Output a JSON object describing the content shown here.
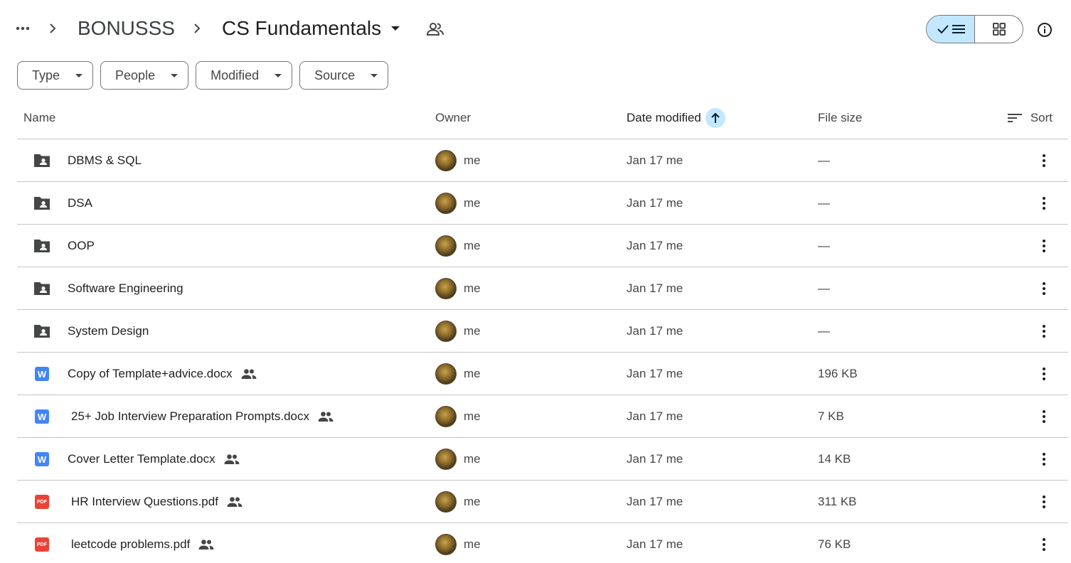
{
  "breadcrumb": {
    "more_label": "More",
    "parent": "BONUSSS",
    "current": "CS Fundamentals"
  },
  "view_toggle": {
    "list_active": true
  },
  "filters": [
    {
      "label": "Type"
    },
    {
      "label": "People"
    },
    {
      "label": "Modified"
    },
    {
      "label": "Source"
    }
  ],
  "table": {
    "headers": {
      "name": "Name",
      "owner": "Owner",
      "date_modified": "Date modified",
      "file_size": "File size",
      "sort": "Sort"
    },
    "rows": [
      {
        "icon": "shared-folder-icon",
        "name": "DBMS & SQL",
        "shared": false,
        "owner": "me",
        "modified": "Jan 17 me",
        "size": "—"
      },
      {
        "icon": "shared-folder-icon",
        "name": "DSA",
        "shared": false,
        "owner": "me",
        "modified": "Jan 17 me",
        "size": "—"
      },
      {
        "icon": "shared-folder-icon",
        "name": "OOP",
        "shared": false,
        "owner": "me",
        "modified": "Jan 17 me",
        "size": "—"
      },
      {
        "icon": "shared-folder-icon",
        "name": "Software Engineering",
        "shared": false,
        "owner": "me",
        "modified": "Jan 17 me",
        "size": "—"
      },
      {
        "icon": "shared-folder-icon",
        "name": "System Design",
        "shared": false,
        "owner": "me",
        "modified": "Jan 17 me",
        "size": "—"
      },
      {
        "icon": "word-doc-icon",
        "name": "Copy of Template+advice.docx",
        "shared": true,
        "owner": "me",
        "modified": "Jan 17 me",
        "size": "196 KB"
      },
      {
        "icon": "word-doc-icon",
        "name": "25+ Job Interview Preparation Prompts.docx",
        "shared": true,
        "owner": "me",
        "modified": "Jan 17 me",
        "size": "7 KB"
      },
      {
        "icon": "word-doc-icon",
        "name": "Cover Letter Template.docx",
        "shared": true,
        "owner": "me",
        "modified": "Jan 17 me",
        "size": "14 KB"
      },
      {
        "icon": "pdf-icon",
        "name": "HR Interview Questions.pdf",
        "shared": true,
        "owner": "me",
        "modified": "Jan 17 me",
        "size": "311 KB"
      },
      {
        "icon": "pdf-icon",
        "name": "leetcode problems.pdf",
        "shared": true,
        "owner": "me",
        "modified": "Jan 17 me",
        "size": "76 KB"
      }
    ]
  },
  "colors": {
    "accent_light": "#c2e7ff",
    "word_blue": "#4285f4",
    "pdf_red": "#ea4335"
  }
}
